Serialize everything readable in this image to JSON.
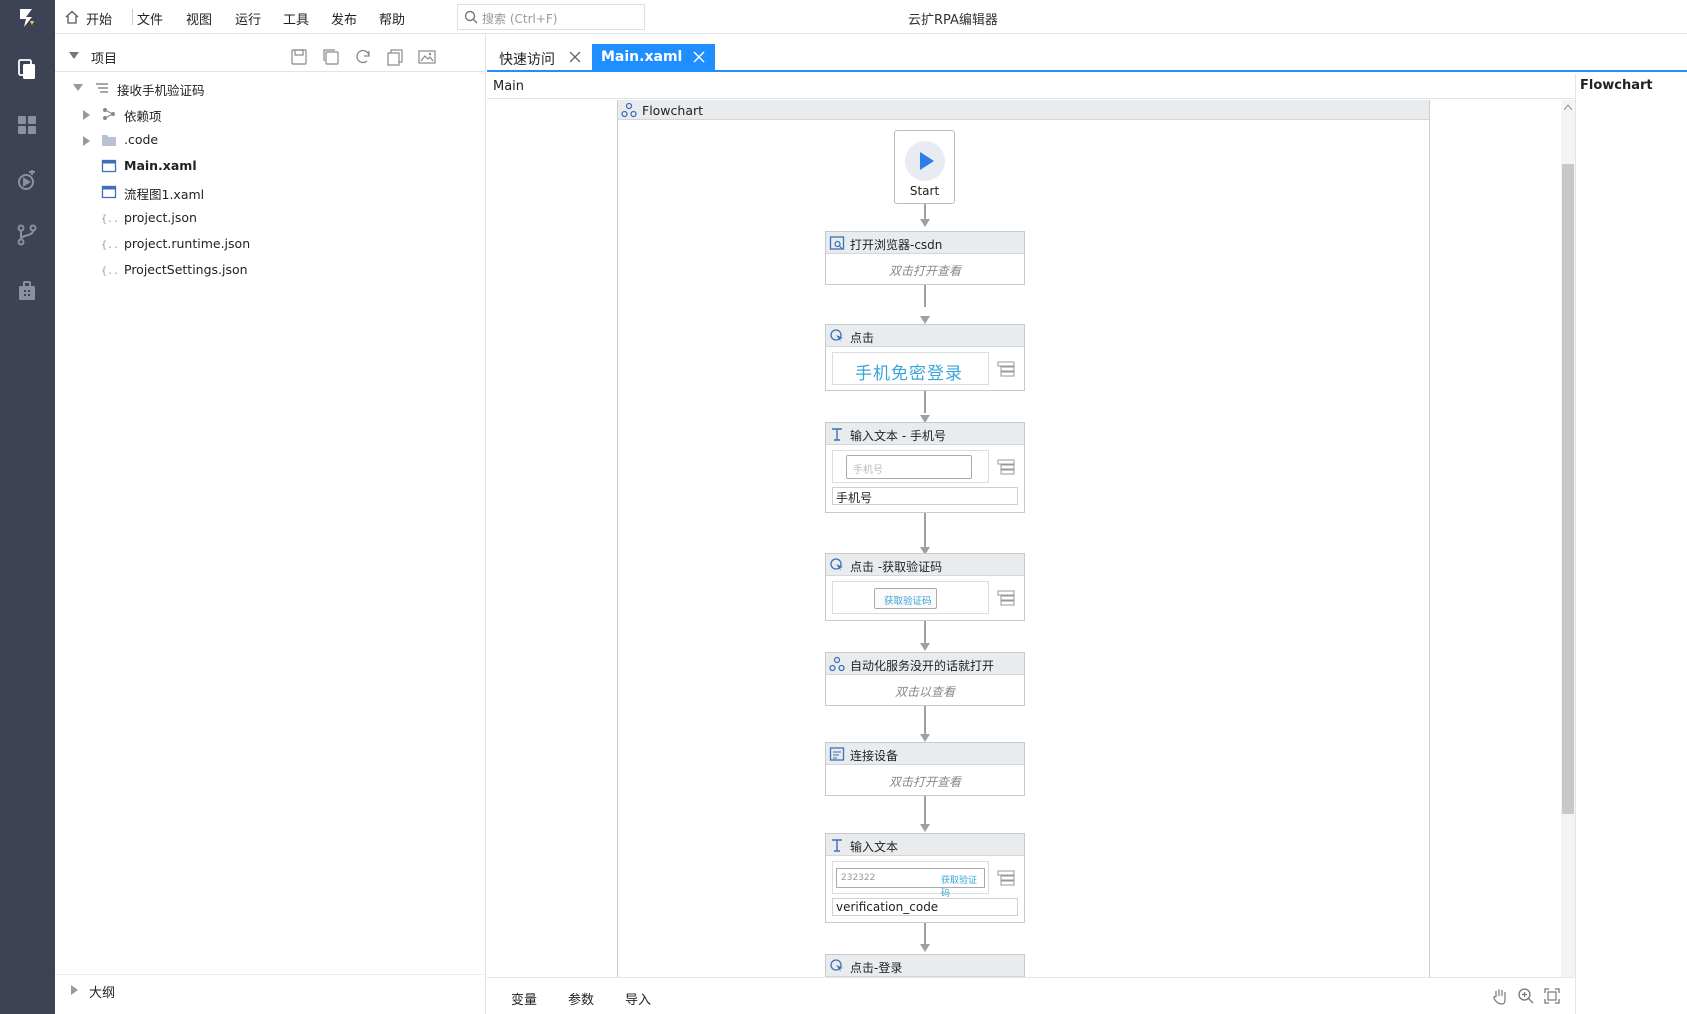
{
  "window": {
    "title": "云扩RPA编辑器"
  },
  "menu": {
    "items": [
      "开始",
      "文件",
      "视图",
      "运行",
      "工具",
      "发布",
      "帮助"
    ],
    "search_placeholder": "搜索 (Ctrl+F)"
  },
  "rail": {
    "icons": [
      "logo-icon",
      "files-icon",
      "dashboard-icon",
      "robot-icon",
      "branch-icon",
      "package-icon"
    ]
  },
  "project_panel": {
    "title": "项目",
    "toolbar_icons": [
      "save-icon",
      "save-all-icon",
      "refresh-icon",
      "copy-icon",
      "image-icon"
    ],
    "root": "接收手机验证码",
    "items": [
      {
        "label": "依赖项",
        "type": "deps"
      },
      {
        "label": ".code",
        "type": "folder"
      },
      {
        "label": "Main.xaml",
        "type": "xaml",
        "bold": true
      },
      {
        "label": "流程图1.xaml",
        "type": "xaml"
      },
      {
        "label": "project.json",
        "type": "json"
      },
      {
        "label": "project.runtime.json",
        "type": "json"
      },
      {
        "label": "ProjectSettings.json",
        "type": "json"
      }
    ],
    "outline_title": "大纲"
  },
  "tabs": [
    {
      "label": "快速访问",
      "active": false
    },
    {
      "label": "Main.xaml",
      "active": true
    }
  ],
  "breadcrumb": "Main",
  "right_panel": {
    "title": "Flowchart"
  },
  "flowchart": {
    "title": "Flowchart",
    "start_label": "Start",
    "activities": [
      {
        "title": "打开浏览器-csdn",
        "hint": "双击打开查看"
      },
      {
        "title": "点击",
        "screenshot_text": "手机免密登录"
      },
      {
        "title": "输入文本 - 手机号",
        "input_placeholder": "手机号",
        "field_value": "手机号"
      },
      {
        "title": "点击 -获取验证码",
        "button_text": "获取验证码"
      },
      {
        "title": "自动化服务没开的话就打开",
        "hint": "双击以查看"
      },
      {
        "title": "连接设备",
        "hint": "双击打开查看"
      },
      {
        "title": "输入文本",
        "input_value": "232322",
        "input_link": "获取验证码",
        "field_value": "verification_code"
      },
      {
        "title": "点击-登录"
      }
    ]
  },
  "bottom_bar": {
    "items": [
      "变量",
      "参数",
      "导入"
    ]
  },
  "colors": {
    "accent": "#1f8fff",
    "rail": "#3d4354"
  }
}
